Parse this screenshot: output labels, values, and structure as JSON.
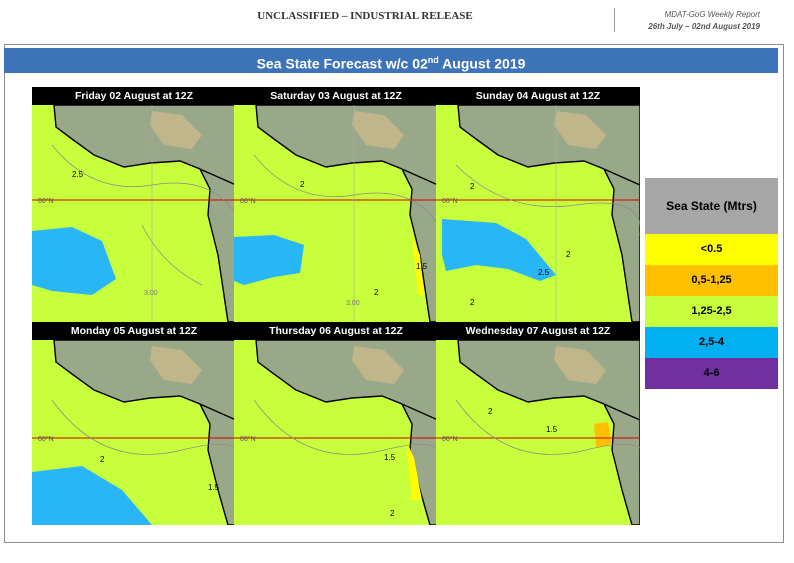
{
  "header": {
    "classification": "UNCLASSIFIED – INDUSTRIAL RELEASE",
    "report_title": "MDAT-GoG Weekly Report",
    "report_period": "26th July – 02nd August 2019"
  },
  "title": {
    "main": "Sea State Forecast w/c 02",
    "sup": "nd",
    "rest": " August 2019"
  },
  "panels": [
    {
      "label": "Friday 02 August at 12Z"
    },
    {
      "label": "Saturday 03 August at 12Z"
    },
    {
      "label": "Sunday 04 August at 12Z"
    },
    {
      "label": "Monday 05 August at 12Z"
    },
    {
      "label": "Thursday 06 August at 12Z"
    },
    {
      "label": "Wednesday 07 August at 12Z"
    }
  ],
  "map_labels": {
    "equator": "00°N",
    "meridian": "3.00",
    "c25": "2.5",
    "c2": "2",
    "c15": "1.5",
    "c1": "1"
  },
  "legend": {
    "title": "Sea State (Mtrs)",
    "items": [
      {
        "label": "<0.5",
        "color": "#ffff00"
      },
      {
        "label": "0,5-1,25",
        "color": "#ffc000"
      },
      {
        "label": "1,25-2,5",
        "color": "#c8ff3c"
      },
      {
        "label": "2,5-4",
        "color": "#00b0f0"
      },
      {
        "label": "4-6",
        "color": "#7030a0"
      }
    ]
  }
}
